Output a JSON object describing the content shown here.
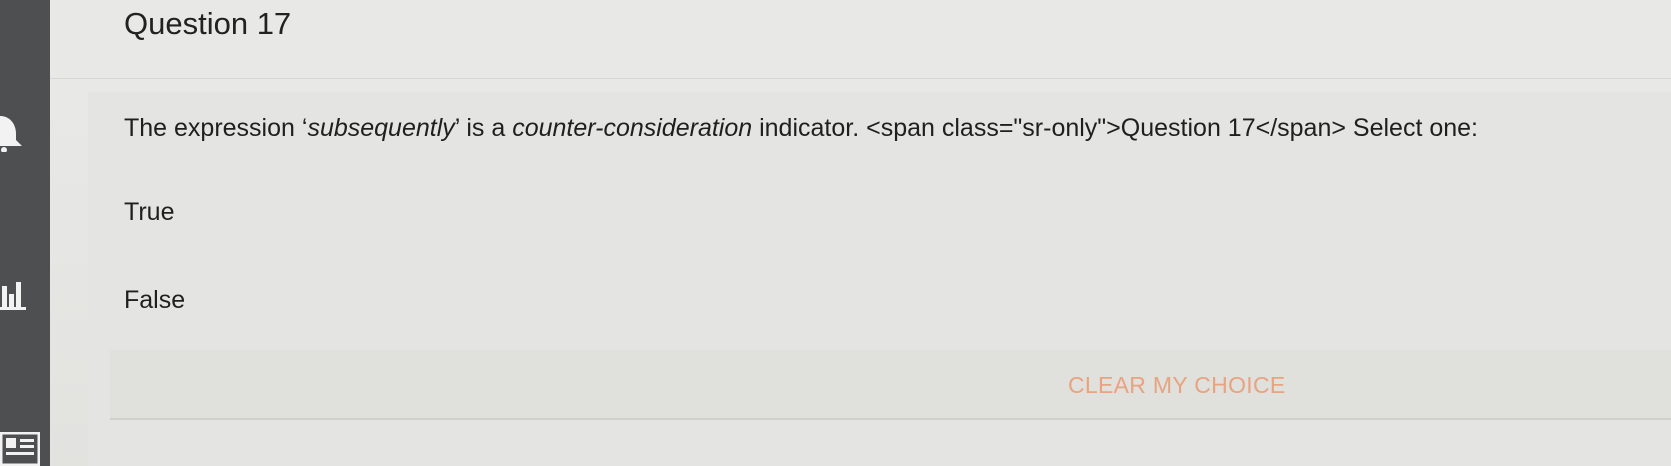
{
  "question": {
    "title": "Question 17",
    "text_prefix": "The expression ‘",
    "text_term": "subsequently",
    "text_middle": "’ is a ",
    "text_indicator": "counter-consideration",
    "text_suffix": " indicator. <span class=\"sr-only\">Question 17</span> Select one:",
    "options": [
      "True",
      "False"
    ],
    "clear_label": "CLEAR MY CHOICE"
  },
  "sidebar": {
    "icons": [
      "bell-icon",
      "chart-icon",
      "grid-icon"
    ]
  },
  "colors": {
    "sidebar": "#4e4f51",
    "clear_button": "#e8a381",
    "text": "#1f1f1f"
  }
}
